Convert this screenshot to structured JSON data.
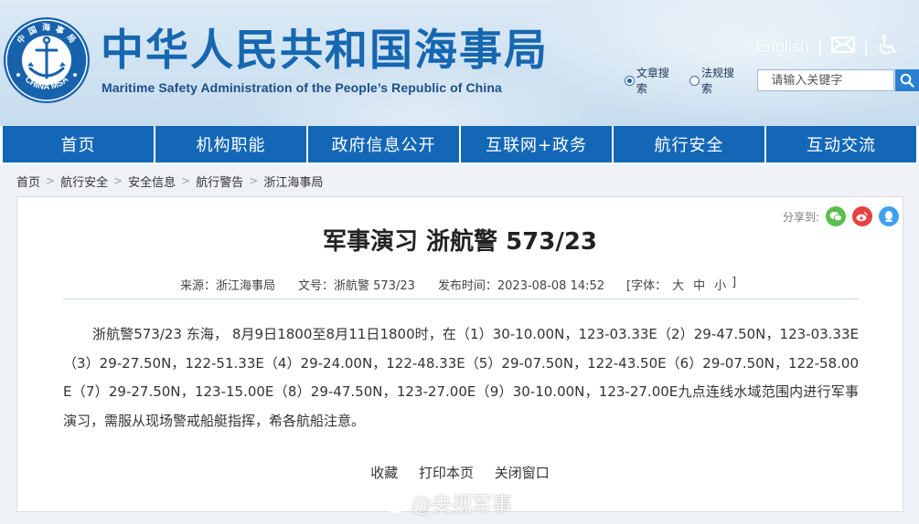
{
  "header": {
    "logo_text_top": "中 国 海 事 局",
    "logo_text_bottom": "CHINA MSA",
    "title_cn": "中华人民共和国海事局",
    "title_en": "Maritime Safety Administration of the People’s Republic of China",
    "lang_link": "English",
    "separator": "|",
    "icons": [
      "mail-icon",
      "accessibility-icon"
    ]
  },
  "search": {
    "options": [
      {
        "label": "文章搜索",
        "selected": true
      },
      {
        "label": "法规搜索",
        "selected": false
      }
    ],
    "placeholder": "请输入关键字"
  },
  "nav": {
    "items": [
      "首页",
      "机构职能",
      "政府信息公开",
      "互联网+政务",
      "航行安全",
      "互动交流"
    ]
  },
  "breadcrumb": [
    "首页",
    "航行安全",
    "安全信息",
    "航行警告",
    "浙江海事局"
  ],
  "breadcrumb_sep": ">",
  "share": {
    "label": "分享到:",
    "icons": [
      "wechat-icon",
      "weibo-icon",
      "qq-icon"
    ],
    "colors": {
      "wechat": "#5bbf4e",
      "weibo": "#e6413f",
      "qq": "#3fa1ee"
    }
  },
  "article": {
    "title": "军事演习 浙航警 573/23",
    "meta": {
      "source": "来源：浙江海事局",
      "doc_no": "文号：浙航警 573/23",
      "date": "发布时间：2023-08-08 14:52",
      "font_label": "[字体：",
      "font_large": "大",
      "font_medium": "中",
      "font_small": "小",
      "font_close": "]"
    },
    "body": "浙航警573/23 东海，  8月9日1800至8月11日1800时，在（1）30-10.00N，123-03.33E（2）29-47.50N，123-03.33E（3）29-27.50N，122-51.33E（4）29-24.00N，122-48.33E（5）29-07.50N，122-43.50E（6）29-07.50N，122-58.00E（7）29-27.50N，123-15.00E（8）29-47.50N，123-27.00E（9）30-10.00N，123-27.00E九点连线水域范围内进行军事演习，需服从现场警戒船艇指挥，希各航船注意。"
  },
  "actions": [
    "收藏",
    "打印本页",
    "关闭窗口"
  ],
  "watermark": "@央视军事",
  "colors": {
    "nav_bg": "#1467b7",
    "title_blue": "#1667b0",
    "search_btn": "#2b7fd0"
  }
}
